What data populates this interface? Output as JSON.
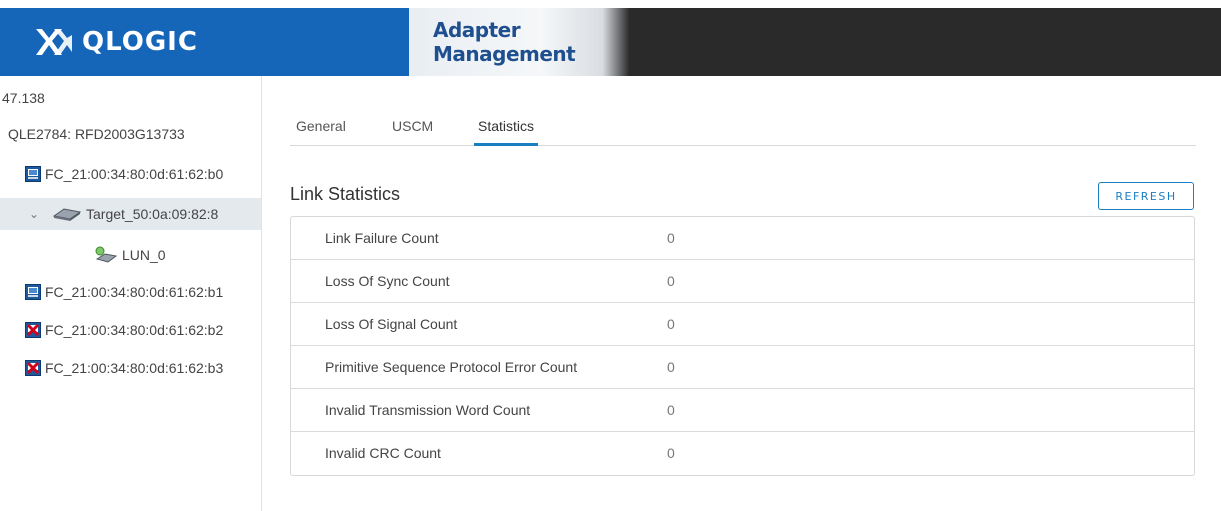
{
  "header": {
    "brand": "QLOGIC",
    "app_title": "Adapter Management"
  },
  "sidebar": {
    "ip_fragment": "47.138",
    "adapter": "QLE2784: RFD2003G13733",
    "ports": [
      {
        "label": "FC_21:00:34:80:0d:61:62:b0",
        "status_icon": "port-ok-icon"
      },
      {
        "label": "FC_21:00:34:80:0d:61:62:b1",
        "status_icon": "port-ok-icon"
      },
      {
        "label": "FC_21:00:34:80:0d:61:62:b2",
        "status_icon": "port-error-icon"
      },
      {
        "label": "FC_21:00:34:80:0d:61:62:b3",
        "status_icon": "port-error-icon"
      }
    ],
    "target": "Target_50:0a:09:82:8",
    "lun": "LUN_0"
  },
  "main": {
    "tabs": [
      {
        "label": "General",
        "active": false
      },
      {
        "label": "USCM",
        "active": false
      },
      {
        "label": "Statistics",
        "active": true
      }
    ],
    "section_title": "Link Statistics",
    "refresh_label": "REFRESH",
    "stats": [
      {
        "label": "Link Failure Count",
        "value": "0"
      },
      {
        "label": "Loss Of Sync Count",
        "value": "0"
      },
      {
        "label": "Loss Of Signal Count",
        "value": "0"
      },
      {
        "label": "Primitive Sequence Protocol Error Count",
        "value": "0"
      },
      {
        "label": "Invalid Transmission Word Count",
        "value": "0"
      },
      {
        "label": "Invalid CRC Count",
        "value": "0"
      }
    ]
  },
  "colors": {
    "brand_blue": "#1565b9",
    "accent": "#1a7fc1",
    "header_dark": "#2a2a2a",
    "selected_row": "#e4e9ee",
    "error_red": "#d0021b"
  }
}
